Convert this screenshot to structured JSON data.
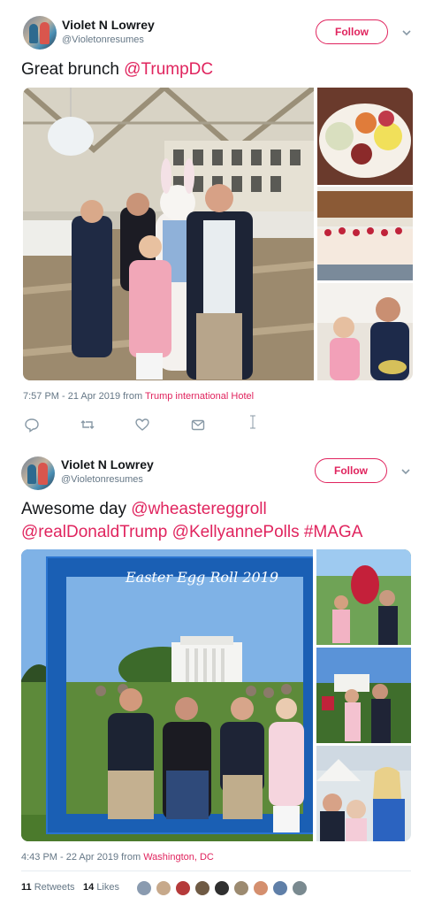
{
  "tweets": [
    {
      "author": {
        "name": "Violet N Lowrey",
        "handle": "@Violetonresumes"
      },
      "follow_label": "Follow",
      "text_plain": "Great brunch ",
      "text_mentions": [
        "@TrumpDC"
      ],
      "timestamp": "7:57 PM - 21 Apr 2019 from ",
      "location": "Trump international Hotel",
      "actions": [
        "reply-icon",
        "retweet-icon",
        "like-icon",
        "direct-message-icon"
      ]
    },
    {
      "author": {
        "name": "Violet N Lowrey",
        "handle": "@Violetonresumes"
      },
      "follow_label": "Follow",
      "text_line1_plain": "Awesome day ",
      "text_line1_mention": "@wheastereggroll",
      "text_line2": [
        "@realDonaldTrump",
        "@KellyannePolls",
        "#MAGA"
      ],
      "sign_text": "Easter Egg Roll 2019",
      "timestamp": "4:43 PM - 22 Apr 2019 from ",
      "location": "Washington, DC",
      "retweets_count": "11",
      "retweets_label": "Retweets",
      "likes_count": "14",
      "likes_label": "Likes"
    }
  ],
  "colors": {
    "accent": "#e0245e",
    "text": "#14171a",
    "secondary": "#657786",
    "sign_blue": "#1a5fb4"
  }
}
